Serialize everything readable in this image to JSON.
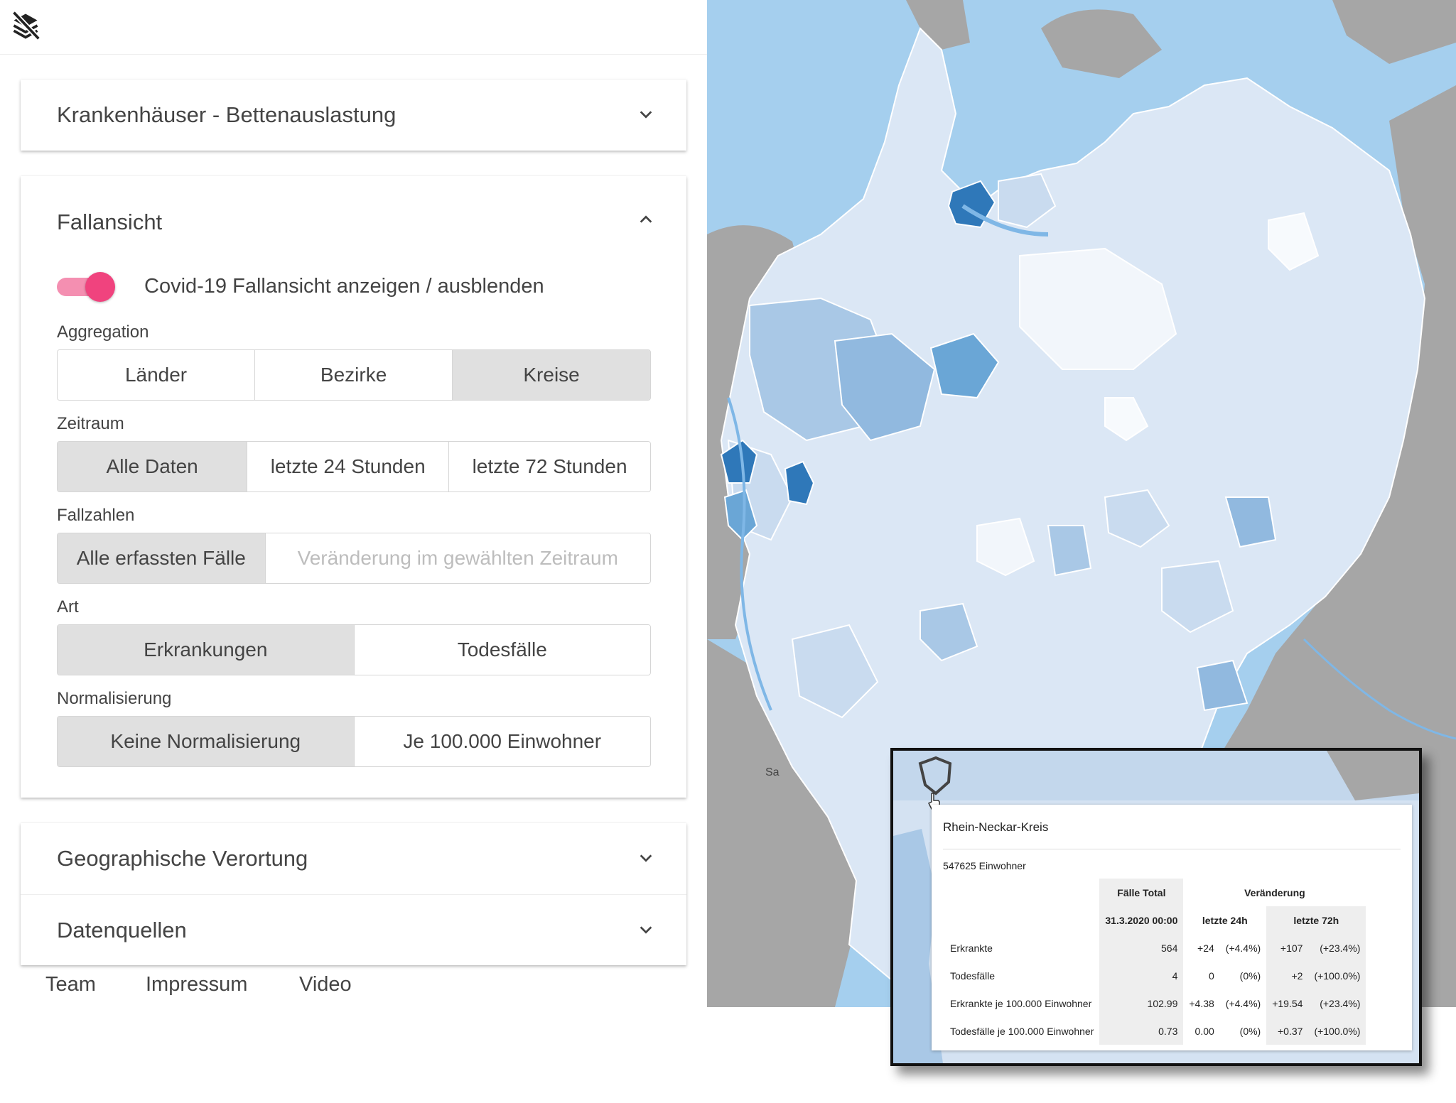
{
  "toolbar": {
    "icon": "layers-off-icon"
  },
  "panels": {
    "hospitals": {
      "title": "Krankenhäuser - Bettenauslastung",
      "state": "collapsed"
    },
    "cases": {
      "title": "Fallansicht",
      "state": "expanded",
      "toggle_label": "Covid-19 Fallansicht anzeigen / ausblenden",
      "toggle_on": true,
      "aggregation": {
        "label": "Aggregation",
        "options": [
          "Länder",
          "Bezirke",
          "Kreise"
        ],
        "selected": "Kreise"
      },
      "zeitraum": {
        "label": "Zeitraum",
        "options": [
          "Alle Daten",
          "letzte 24 Stunden",
          "letzte 72 Stunden"
        ],
        "selected": "Alle Daten"
      },
      "fallzahlen": {
        "label": "Fallzahlen",
        "options": [
          "Alle erfassten Fälle",
          "Veränderung im gewählten Zeitraum"
        ],
        "selected": "Alle erfassten Fälle",
        "disabled": "Veränderung im gewählten Zeitraum"
      },
      "art": {
        "label": "Art",
        "options": [
          "Erkrankungen",
          "Todesfälle"
        ],
        "selected": "Erkrankungen"
      },
      "normalisierung": {
        "label": "Normalisierung",
        "options": [
          "Keine Normalisierung",
          "Je 100.000 Einwohner"
        ],
        "selected": "Keine Normalisierung"
      }
    },
    "geo": {
      "title": "Geographische Verortung",
      "state": "collapsed"
    },
    "sources": {
      "title": "Datenquellen",
      "state": "collapsed"
    }
  },
  "footer": {
    "links": [
      "Team",
      "Impressum",
      "Video"
    ]
  },
  "map": {
    "place_label": "Sa",
    "colors": {
      "water": "#a5cfee",
      "land_outside": "#a6a6a6",
      "region_light": "#e6eef8",
      "region_mid": "#a9c8e6",
      "region_dark": "#2f78b9"
    }
  },
  "tooltip": {
    "region": "Rhein-Neckar-Kreis",
    "population": "547625 Einwohner",
    "headers": {
      "total": "Fälle Total",
      "change": "Veränderung",
      "timestamp": "31.3.2020 00:00",
      "h24": "letzte 24h",
      "h72": "letzte 72h"
    },
    "rows": [
      {
        "label": "Erkrankte",
        "total": "564",
        "d24": "+24",
        "p24": "(+4.4%)",
        "d72": "+107",
        "p72": "(+23.4%)"
      },
      {
        "label": "Todesfälle",
        "total": "4",
        "d24": "0",
        "p24": "(0%)",
        "d72": "+2",
        "p72": "(+100.0%)"
      },
      {
        "label": "Erkrankte je 100.000 Einwohner",
        "total": "102.99",
        "d24": "+4.38",
        "p24": "(+4.4%)",
        "d72": "+19.54",
        "p72": "(+23.4%)"
      },
      {
        "label": "Todesfälle je 100.000 Einwohner",
        "total": "0.73",
        "d24": "0.00",
        "p24": "(0%)",
        "d72": "+0.37",
        "p72": "(+100.0%)"
      }
    ]
  }
}
